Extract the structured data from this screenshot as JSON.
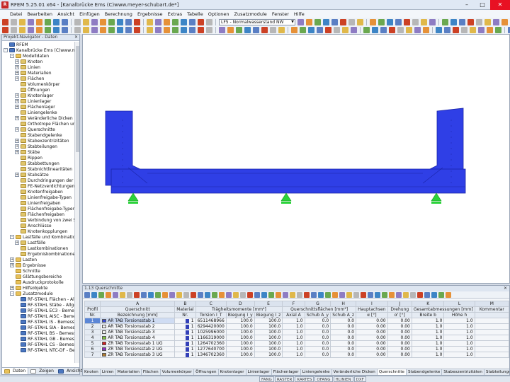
{
  "window": {
    "title": "RFEM 5.25.01 x64 - [Kanalbrücke Ems (C)www.meyer-schubart.de*]",
    "minimize": "–",
    "maximize": "□",
    "close": "✕"
  },
  "menu": [
    "Datei",
    "Bearbeiten",
    "Ansicht",
    "Einfügen",
    "Berechnung",
    "Ergebnisse",
    "Extras",
    "Tabelle",
    "Optionen",
    "Zusatzmodule",
    "Fenster",
    "Hilfe"
  ],
  "toolbar": {
    "loadcase": "LF5 - Normalwasserstand NW"
  },
  "navigator": {
    "title": "Projekt-Navigator - Daten",
    "root": "RFEM",
    "model": "Kanalbrücke Ems (C)www.meyer",
    "items": [
      "Modelldaten",
      "Knoten",
      "Linien",
      "Materialien",
      "Flächen",
      "Volumenkörper",
      "Öffnungen",
      "Knotenlager",
      "Linienlager",
      "Flächenlager",
      "Liniengelenke",
      "Veränderliche Dicken",
      "Orthotrope Flächen und Me",
      "Querschnitte",
      "Stabendgelenke",
      "Stabexzentrizitäten",
      "Stabteilungen",
      "Stäbe",
      "Rippen",
      "Stabbettungen",
      "Stabnichtlinearitäten",
      "Stabsätze",
      "Durchdringungen der Fläche",
      "FE-Netzverdichtungen",
      "Knotenfreigaben",
      "Linienfreigabe-Typen",
      "Linienfreigaben",
      "Flächenfreigabe-Typen",
      "Flächenfreigaben",
      "Verbindung von zwei Stäber",
      "Anschlüsse",
      "Knotenkopplungen",
      "Lastfälle und Kombinationen",
      "Lastfälle",
      "Lastkombinationen",
      "Ergebniskombinationen",
      "Lasten",
      "Ergebnisse",
      "Schnitte",
      "Glättungsbereiche",
      "Ausdruckprotokolle",
      "Hilfsobjekte",
      "Zusatzmodule",
      "RF-STAHL Flächen - Allgem",
      "RF-STAHL Stäbe - Allgemei",
      "RF-STAHL EC3 - Bemessung",
      "RF-STAHL AISC - Bemessun",
      "RF-STAHL IS - Bemessung n",
      "RF-STAHL SIA - Bemessung",
      "RF-STAHL BS - Bemessung n",
      "RF-STAHL GB - Bemessung n",
      "RF-STAHL CS - Bemessung",
      "RF-STAHL NTC-DF - Bemess"
    ],
    "tabs": [
      "Daten",
      "Zeigen",
      "Ansichten"
    ]
  },
  "panel": {
    "title": "1.13 Querschnitte",
    "letters": [
      "A",
      "B",
      "C",
      "D",
      "E",
      "F",
      "G",
      "H",
      "I",
      "J",
      "K",
      "L",
      "M"
    ],
    "head1": {
      "profil": "Profil",
      "qs": "Querschnitt",
      "mat": "Material",
      "traeg": "Trägheitsmomente [mm⁴]",
      "qsfl": "Querschnittsflächen [mm²]",
      "haupt": "Hauptachsen",
      "dreh": "Drehung",
      "gesamt": "Gesamtabmessungen [mm]",
      "komm": "Kommentar"
    },
    "head2": [
      "Nr.",
      "Bezeichnung [mm]",
      "Nr.",
      "Torsion I_T",
      "Biegung I_y",
      "Biegung I_z",
      "Axial A",
      "Schub A_y",
      "Schub A_z",
      "α [°]",
      "α' [°]",
      "Breite b",
      "Höhe h",
      ""
    ],
    "rows": [
      {
        "nr": "1",
        "name": "AR TAB Torsionsstab 1",
        "color": "#3b4bd8",
        "mat": "1",
        "it": "6511468966",
        "iy": "100.0",
        "iz": "100.0",
        "a": "1.0",
        "ay": "0.0",
        "az": "0.0",
        "al": "0.00",
        "al2": "0.00",
        "b": "1.0",
        "h": "1.0"
      },
      {
        "nr": "2",
        "name": "AR TAB Torsionsstab 2",
        "color": "#f2f2f2",
        "mat": "1",
        "it": "6294420000",
        "iy": "100.0",
        "iz": "100.0",
        "a": "1.0",
        "ay": "0.0",
        "az": "0.0",
        "al": "0.00",
        "al2": "0.00",
        "b": "1.0",
        "h": "1.0"
      },
      {
        "nr": "3",
        "name": "AR TAB Torsionsstab 3",
        "color": "#f2f2f2",
        "mat": "1",
        "it": "1025996000",
        "iy": "100.0",
        "iz": "100.0",
        "a": "1.0",
        "ay": "0.0",
        "az": "0.0",
        "al": "0.00",
        "al2": "0.00",
        "b": "1.0",
        "h": "1.0"
      },
      {
        "nr": "4",
        "name": "AR TAB Torsionsstab 4",
        "color": "#7fbf3f",
        "mat": "1",
        "it": "1166319000",
        "iy": "100.0",
        "iz": "100.0",
        "a": "1.0",
        "ay": "0.0",
        "az": "0.0",
        "al": "0.00",
        "al2": "0.00",
        "b": "1.0",
        "h": "1.0"
      },
      {
        "nr": "5",
        "name": "ZR TAB Torsionsstab 1 UG",
        "color": "#d42020",
        "mat": "1",
        "it": "1264702360",
        "iy": "100.0",
        "iz": "100.0",
        "a": "1.0",
        "ay": "0.0",
        "az": "0.0",
        "al": "0.00",
        "al2": "0.00",
        "b": "1.0",
        "h": "1.0"
      },
      {
        "nr": "6",
        "name": "ZR TAB Torsionsstab 2 UG",
        "color": "#8a2ec0",
        "mat": "1",
        "it": "1277640700",
        "iy": "100.0",
        "iz": "100.0",
        "a": "1.0",
        "ay": "0.0",
        "az": "0.0",
        "al": "0.00",
        "al2": "0.00",
        "b": "1.0",
        "h": "1.0"
      },
      {
        "nr": "7",
        "name": "ZR TAB Torsionsstab 3 UG",
        "color": "#b07a30",
        "mat": "1",
        "it": "1346702360",
        "iy": "100.0",
        "iz": "100.0",
        "a": "1.0",
        "ay": "0.0",
        "az": "0.0",
        "al": "0.00",
        "al2": "0.00",
        "b": "1.0",
        "h": "1.0"
      }
    ],
    "tabs": [
      "Knoten",
      "Linien",
      "Materialien",
      "Flächen",
      "Volumenkörper",
      "Öffnungen",
      "Knotenlager",
      "Linienlager",
      "Flächenlager",
      "Liniengelenke",
      "Veränderliche Dicken",
      "Querschnitte",
      "Stabendgelenke",
      "Stabexzentrizitäten",
      "Stabteilungen",
      "Stäbe",
      "Stabbettungen"
    ],
    "active_tab": "Querschnitte"
  },
  "status": [
    "FANG",
    "RASTER",
    "KARTES",
    "OFANG",
    "HLINIEN",
    "DXF"
  ],
  "colors": {
    "model": "#2f3fe6",
    "support": "#2bd23a"
  }
}
